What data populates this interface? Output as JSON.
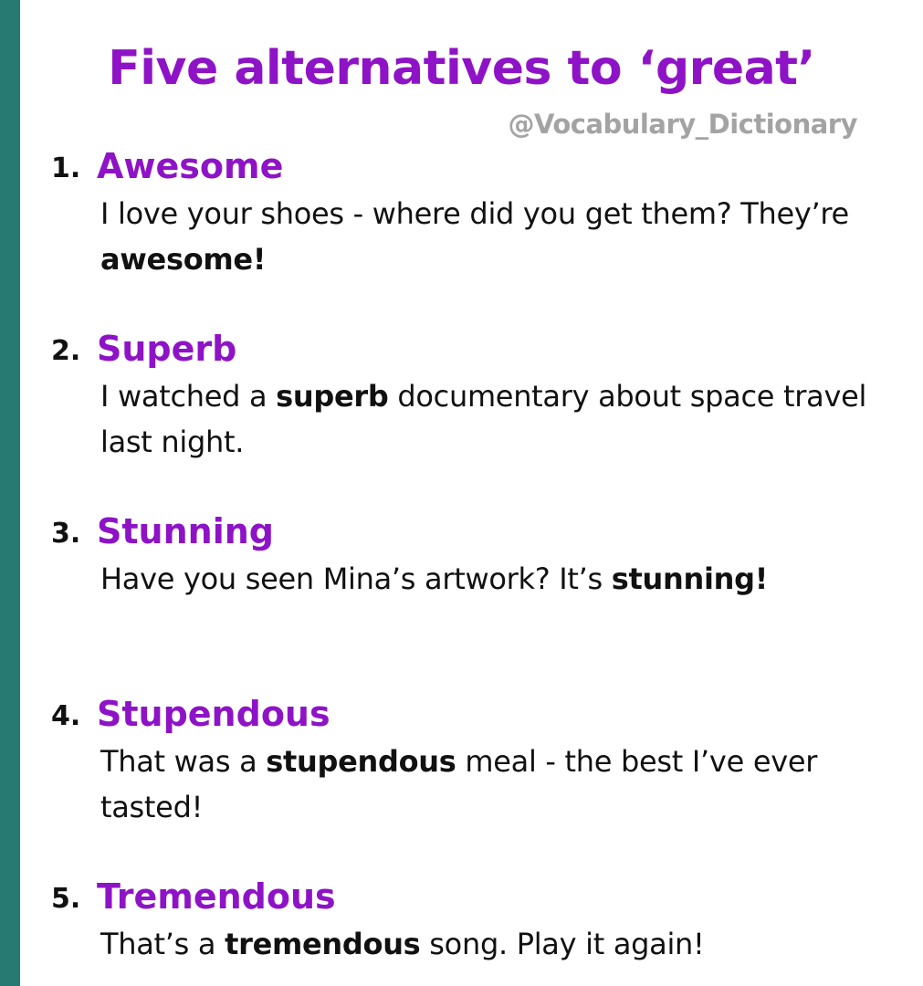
{
  "title": "Five alternatives to ‘great’",
  "watermark": "@Vocabulary_Dictionary",
  "colors": {
    "accent_purple": "#8e13c6",
    "sidebar_teal": "#267a72",
    "watermark_gray": "#a3a3a3",
    "text": "#111111"
  },
  "entries": [
    {
      "number": "1.",
      "word": "Awesome",
      "example": [
        {
          "text": "I love your shoes - where did you get them? They’re ",
          "bold": false
        },
        {
          "text": "awesome!",
          "bold": true
        }
      ]
    },
    {
      "number": "2.",
      "word": "Superb",
      "example": [
        {
          "text": "I watched a ",
          "bold": false
        },
        {
          "text": "superb",
          "bold": true
        },
        {
          "text": " documentary about space travel last night.",
          "bold": false
        }
      ]
    },
    {
      "number": "3.",
      "word": "Stunning",
      "example": [
        {
          "text": "Have you seen Mina’s artwork? It’s ",
          "bold": false
        },
        {
          "text": "stunning!",
          "bold": true
        }
      ]
    },
    {
      "number": "4.",
      "word": "Stupendous",
      "example": [
        {
          "text": "That was a ",
          "bold": false
        },
        {
          "text": "stupendous",
          "bold": true
        },
        {
          "text": " meal - the best I’ve ever tasted!",
          "bold": false
        }
      ]
    },
    {
      "number": "5.",
      "word": "Tremendous",
      "example": [
        {
          "text": "That’s a ",
          "bold": false
        },
        {
          "text": "tremendous",
          "bold": true
        },
        {
          "text": " song. Play it again!",
          "bold": false
        }
      ]
    }
  ]
}
